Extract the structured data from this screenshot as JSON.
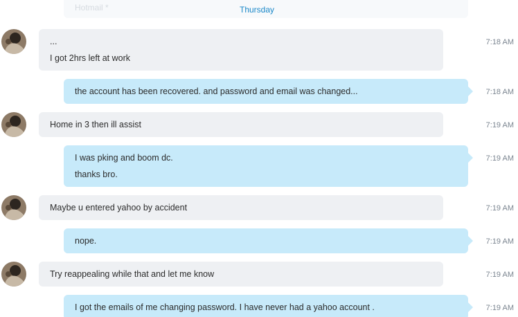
{
  "ghost_text": "Hotmail *",
  "day_divider": "Thursday",
  "messages": [
    {
      "dir": "in",
      "lines": [
        "...",
        "I got 2hrs left at work"
      ],
      "time": "7:18 AM"
    },
    {
      "dir": "out",
      "lines": [
        "the account has been recovered. and password and email was changed..."
      ],
      "time": "7:18 AM"
    },
    {
      "dir": "in",
      "lines": [
        "Home in 3 then ill assist"
      ],
      "time": "7:19 AM"
    },
    {
      "dir": "out",
      "lines": [
        "I was pking and boom dc.",
        "thanks bro."
      ],
      "time": "7:19 AM"
    },
    {
      "dir": "in",
      "lines": [
        "Maybe u entered yahoo by accident"
      ],
      "time": "7:19 AM"
    },
    {
      "dir": "out",
      "lines": [
        "nope."
      ],
      "time": "7:19 AM"
    },
    {
      "dir": "in",
      "lines": [
        "Try reappealing while that and let me know"
      ],
      "time": "7:19 AM"
    },
    {
      "dir": "out",
      "lines": [
        "I got the emails of me changing password. I have never had a yahoo account ."
      ],
      "time": "7:19 AM"
    }
  ],
  "colors": {
    "incoming_bubble": "#eef0f3",
    "outgoing_bubble": "#c7eafa",
    "day_label": "#1a88c8",
    "timestamp": "#7b8590"
  }
}
